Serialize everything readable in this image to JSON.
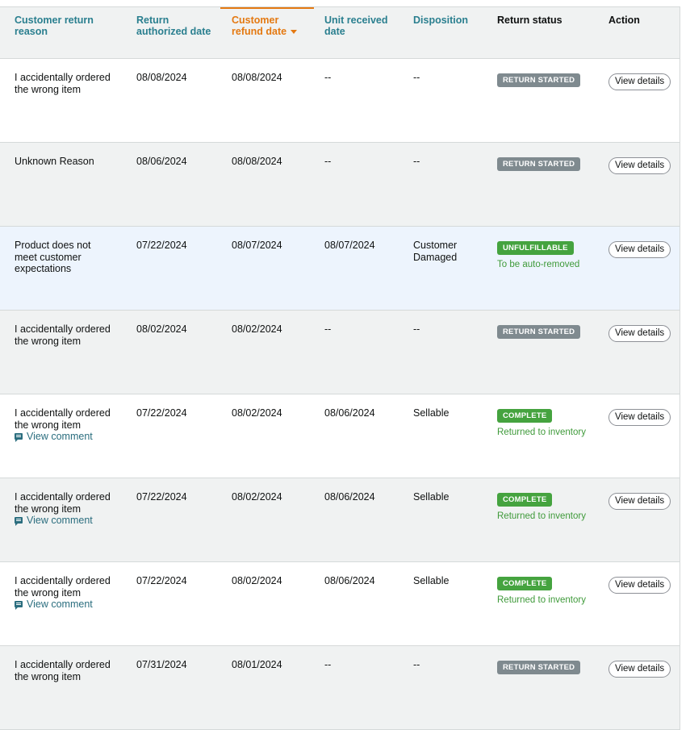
{
  "headers": {
    "reason": [
      "Customer return",
      "reason"
    ],
    "authorized": [
      "Return",
      "authorized date"
    ],
    "refund": [
      "Customer",
      "refund date"
    ],
    "received": [
      "Unit received",
      "date"
    ],
    "disposition": "Disposition",
    "status": "Return status",
    "action": "Action"
  },
  "sort": {
    "column": "Customer refund date",
    "direction": "descending",
    "icon": "sort-desc-icon"
  },
  "colors": {
    "header_link": "#2a7f8f",
    "sorted_header": "#e47911",
    "badge_gray": "#7f8a8f",
    "badge_green": "#45a33f",
    "substatus_green": "#3f9a3a",
    "highlight_row": "#edf4fd"
  },
  "rows": [
    {
      "reason": [
        "I accidentally ordered",
        "the wrong item"
      ],
      "authorized": "08/08/2024",
      "refund": "08/08/2024",
      "received": "--",
      "disposition": [
        "--"
      ],
      "status": "RETURN STARTED",
      "substatus": "",
      "comment": "",
      "action": "View details"
    },
    {
      "reason": [
        "Unknown Reason"
      ],
      "authorized": "08/06/2024",
      "refund": "08/08/2024",
      "received": "--",
      "disposition": [
        "--"
      ],
      "status": "RETURN STARTED",
      "substatus": "",
      "comment": "",
      "action": "View details"
    },
    {
      "reason": [
        "Product does not",
        "meet customer",
        "expectations"
      ],
      "authorized": "07/22/2024",
      "refund": "08/07/2024",
      "received": "08/07/2024",
      "disposition": [
        "Customer",
        "Damaged"
      ],
      "status": "UNFULFILLABLE",
      "substatus": "To be auto-removed",
      "comment": "",
      "action": "View details"
    },
    {
      "reason": [
        "I accidentally ordered",
        "the wrong item"
      ],
      "authorized": "08/02/2024",
      "refund": "08/02/2024",
      "received": "--",
      "disposition": [
        "--"
      ],
      "status": "RETURN STARTED",
      "substatus": "",
      "comment": "",
      "action": "View details"
    },
    {
      "reason": [
        "I accidentally ordered",
        "the wrong item"
      ],
      "authorized": "07/22/2024",
      "refund": "08/02/2024",
      "received": "08/06/2024",
      "disposition": [
        "Sellable"
      ],
      "status": "COMPLETE",
      "substatus": "Returned to inventory",
      "comment": "View comment",
      "action": "View details"
    },
    {
      "reason": [
        "I accidentally ordered",
        "the wrong item"
      ],
      "authorized": "07/22/2024",
      "refund": "08/02/2024",
      "received": "08/06/2024",
      "disposition": [
        "Sellable"
      ],
      "status": "COMPLETE",
      "substatus": "Returned to inventory",
      "comment": "View comment",
      "action": "View details"
    },
    {
      "reason": [
        "I accidentally ordered",
        "the wrong item"
      ],
      "authorized": "07/22/2024",
      "refund": "08/02/2024",
      "received": "08/06/2024",
      "disposition": [
        "Sellable"
      ],
      "status": "COMPLETE",
      "substatus": "Returned to inventory",
      "comment": "View comment",
      "action": "View details"
    },
    {
      "reason": [
        "I accidentally ordered",
        "the wrong item"
      ],
      "authorized": "07/31/2024",
      "refund": "08/01/2024",
      "received": "--",
      "disposition": [
        "--"
      ],
      "status": "RETURN STARTED",
      "substatus": "",
      "comment": "",
      "action": "View details"
    }
  ]
}
